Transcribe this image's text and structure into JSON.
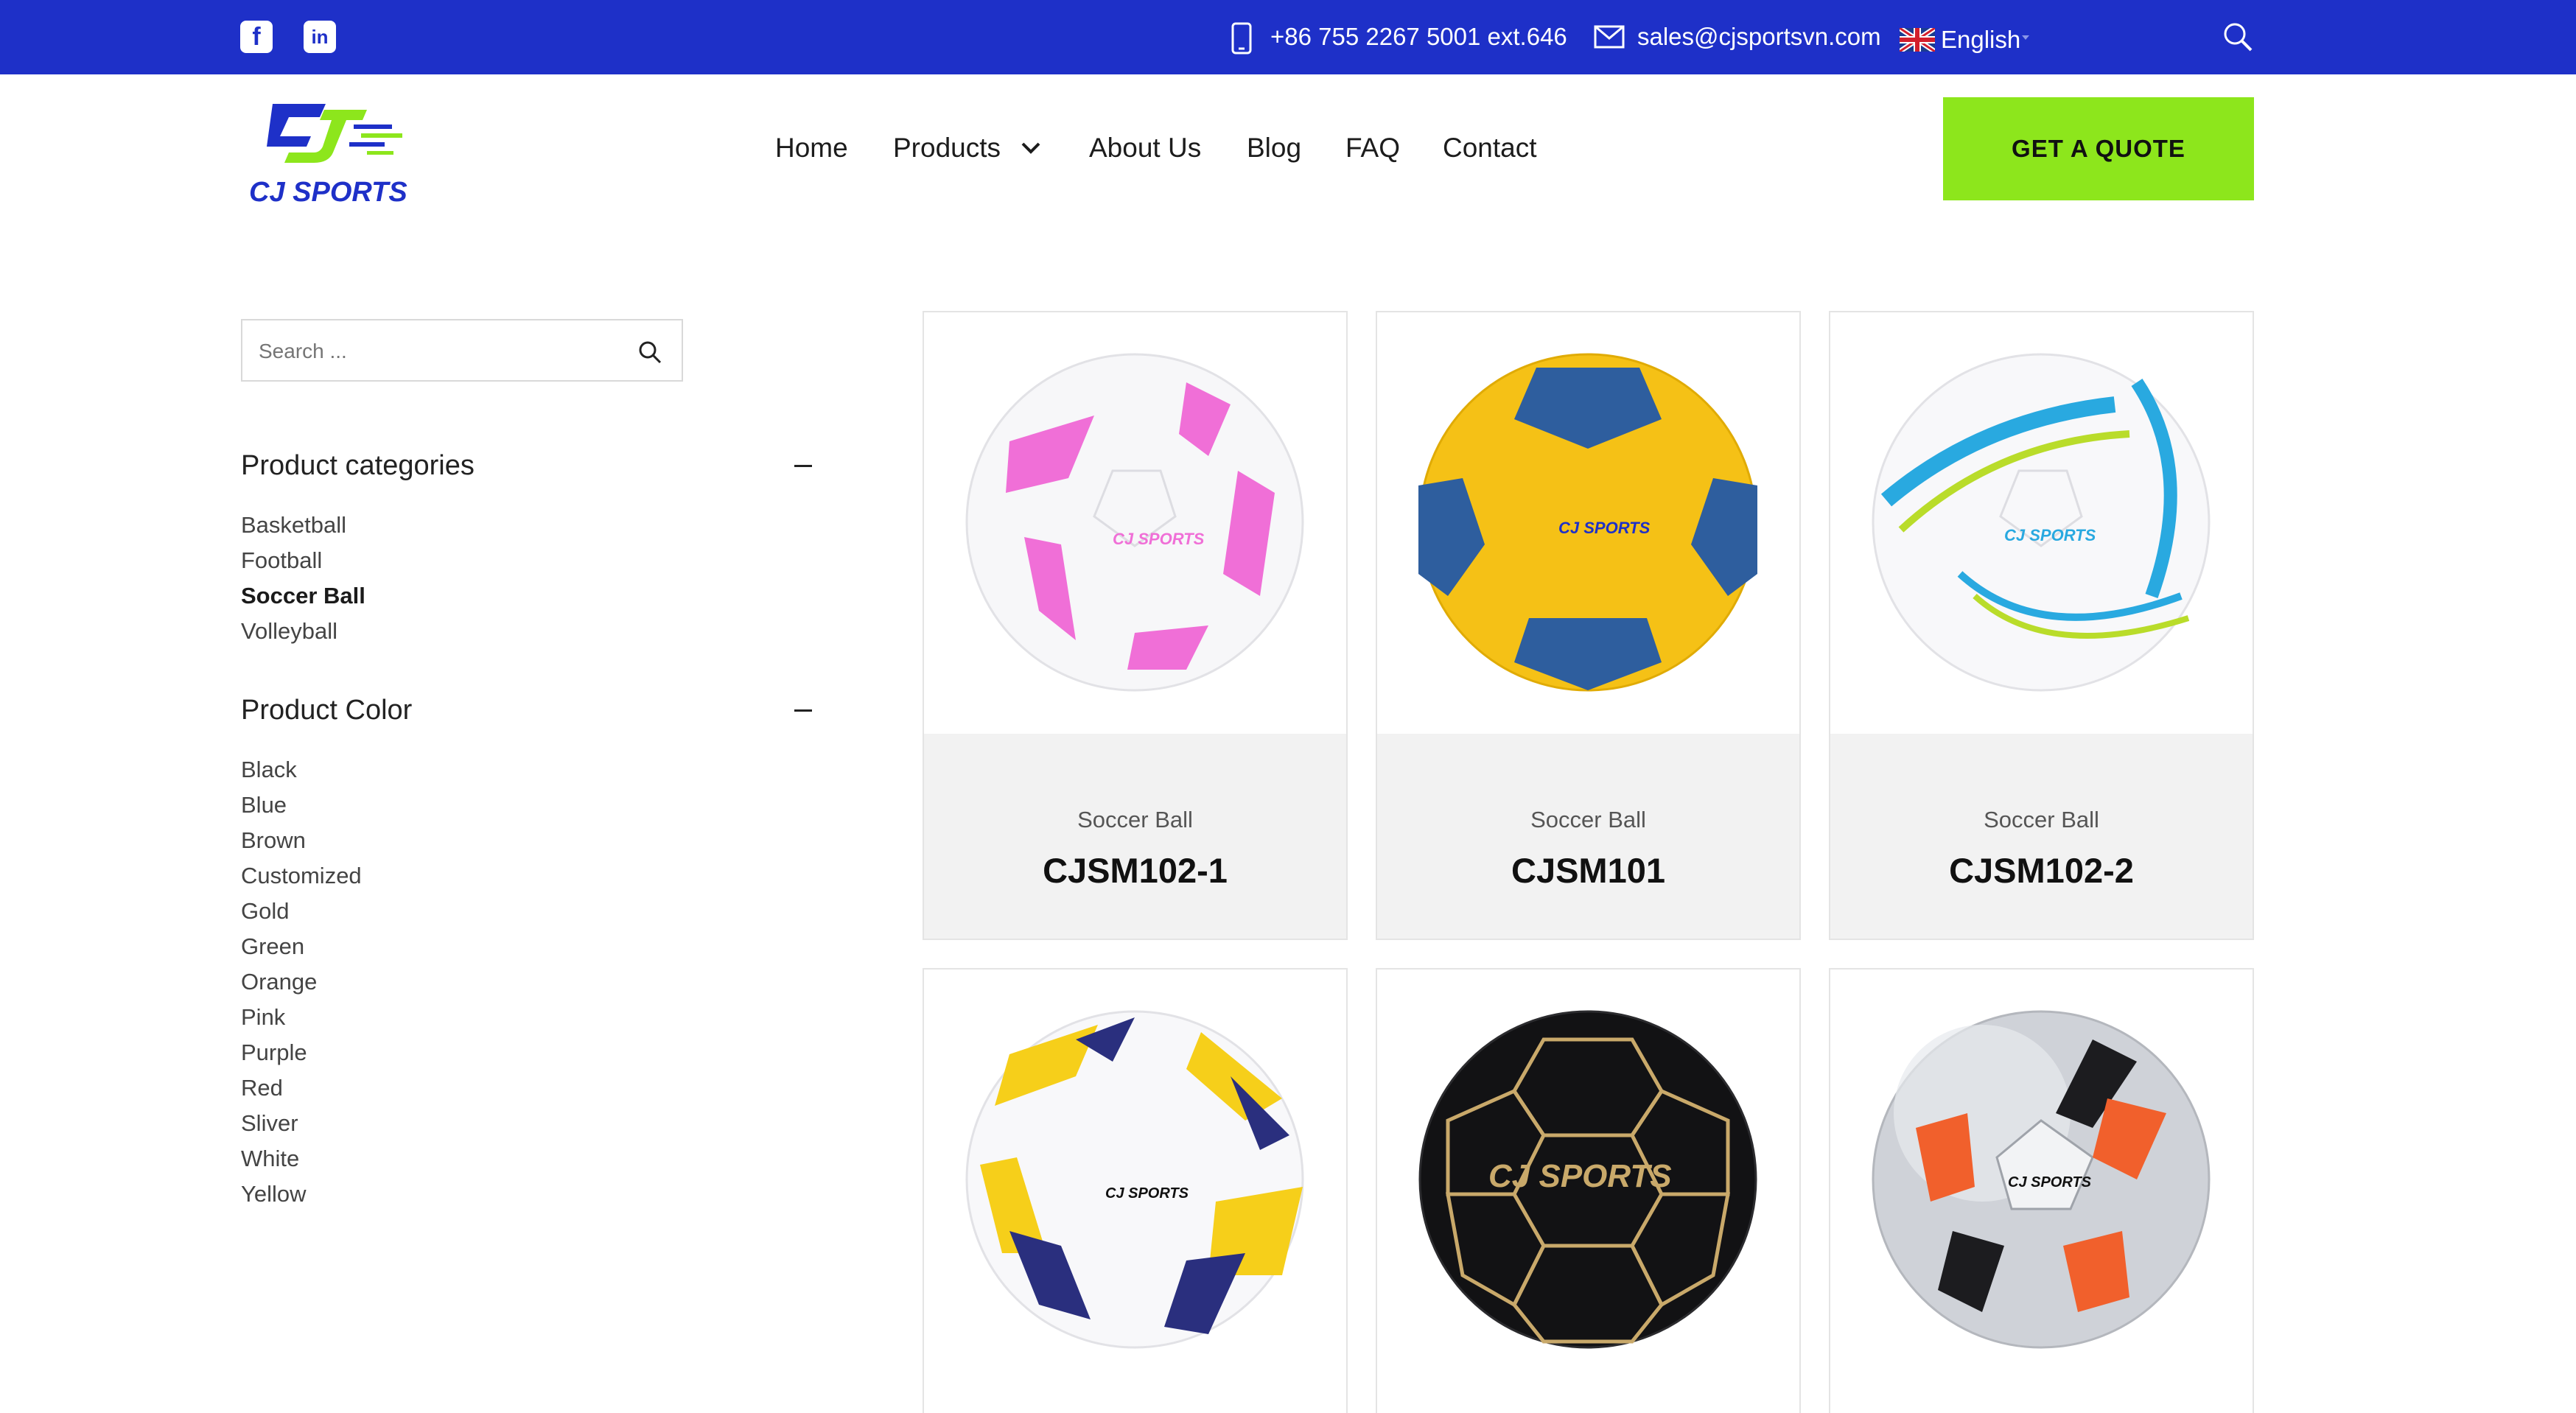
{
  "topbar": {
    "social": [
      {
        "name": "facebook-icon",
        "glyph": "f"
      },
      {
        "name": "linkedin-icon",
        "glyph": "in"
      }
    ],
    "phone": "+86 755 2267 5001 ext.646",
    "email": "sales@cjsportsvn.com",
    "language": "English"
  },
  "brand": {
    "logo_text": "CJ SPORTS",
    "colors": {
      "primary": "#1e30c8",
      "accent": "#8de61c"
    }
  },
  "nav": {
    "items": [
      "Home",
      "Products",
      "About Us",
      "Blog",
      "FAQ",
      "Contact"
    ],
    "cta": "GET A QUOTE"
  },
  "sidebar": {
    "search_placeholder": "Search ...",
    "categories": {
      "title": "Product categories",
      "items": [
        "Basketball",
        "Football",
        "Soccer Ball",
        "Volleyball"
      ],
      "active": "Soccer Ball"
    },
    "colors": {
      "title": "Product Color",
      "items": [
        "Black",
        "Blue",
        "Brown",
        "Customized",
        "Gold",
        "Green",
        "Orange",
        "Pink",
        "Purple",
        "Red",
        "Sliver",
        "White",
        "Yellow"
      ]
    }
  },
  "products": [
    {
      "category": "Soccer Ball",
      "name": "CJSM102-1"
    },
    {
      "category": "Soccer Ball",
      "name": "CJSM101"
    },
    {
      "category": "Soccer Ball",
      "name": "CJSM102-2"
    },
    {
      "category": "",
      "name": ""
    },
    {
      "category": "",
      "name": ""
    },
    {
      "category": "",
      "name": ""
    }
  ]
}
